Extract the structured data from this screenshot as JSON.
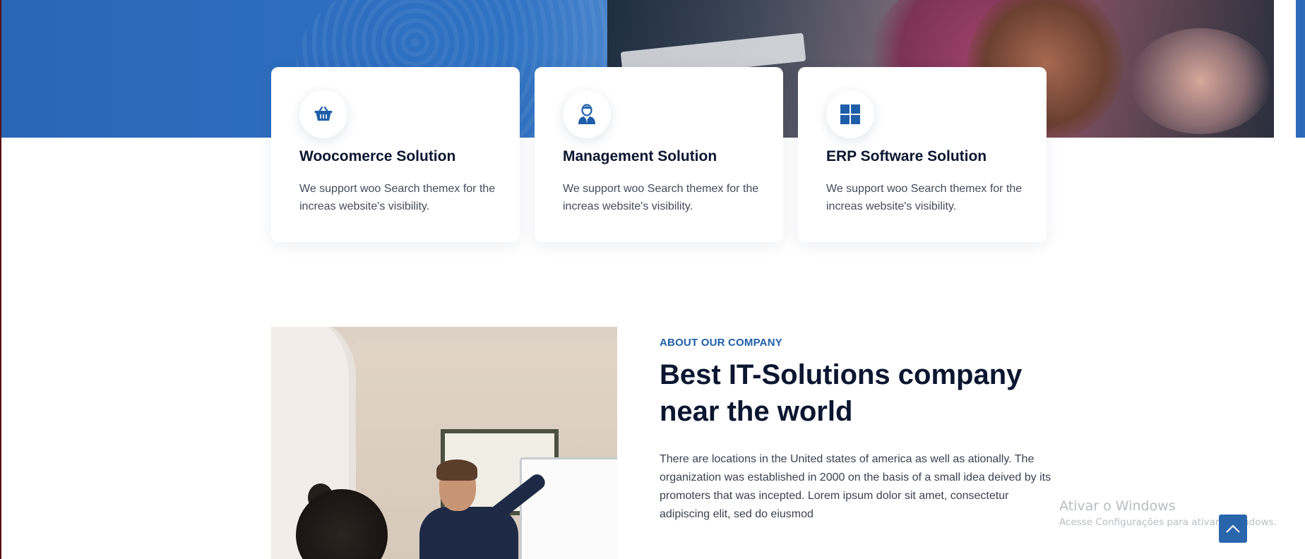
{
  "cards": [
    {
      "title": "Woocomerce Solution",
      "text": "We support woo Search themex for the increas website's visibility.",
      "icon": "basket-icon"
    },
    {
      "title": "Management Solution",
      "text": "We support woo Search themex for the increas website's visibility.",
      "icon": "businessman-icon"
    },
    {
      "title": "ERP Software Solution",
      "text": "We support woo Search themex for the increas website's visibility.",
      "icon": "windows-grid-icon"
    }
  ],
  "about": {
    "eyebrow": "ABOUT OUR COMPANY",
    "headline": "Best IT-Solutions company near the world",
    "body": "There are locations in the United states of america as well as ationally. The organization was established in 2000 on the basis of a small idea deived by its promoters that was incepted. Lorem ipsum dolor sit amet, consectetur adipiscing elit, sed do eiusmod"
  },
  "windows_watermark": {
    "title": "Ativar o Windows",
    "subtitle": "Acesse Configurações para ativar o Windows."
  },
  "colors": {
    "accent": "#1f5ea8",
    "heading": "#0b1630",
    "hero_blue": "#2a66b8"
  },
  "scroll_top_icon": "chevron-up-icon"
}
